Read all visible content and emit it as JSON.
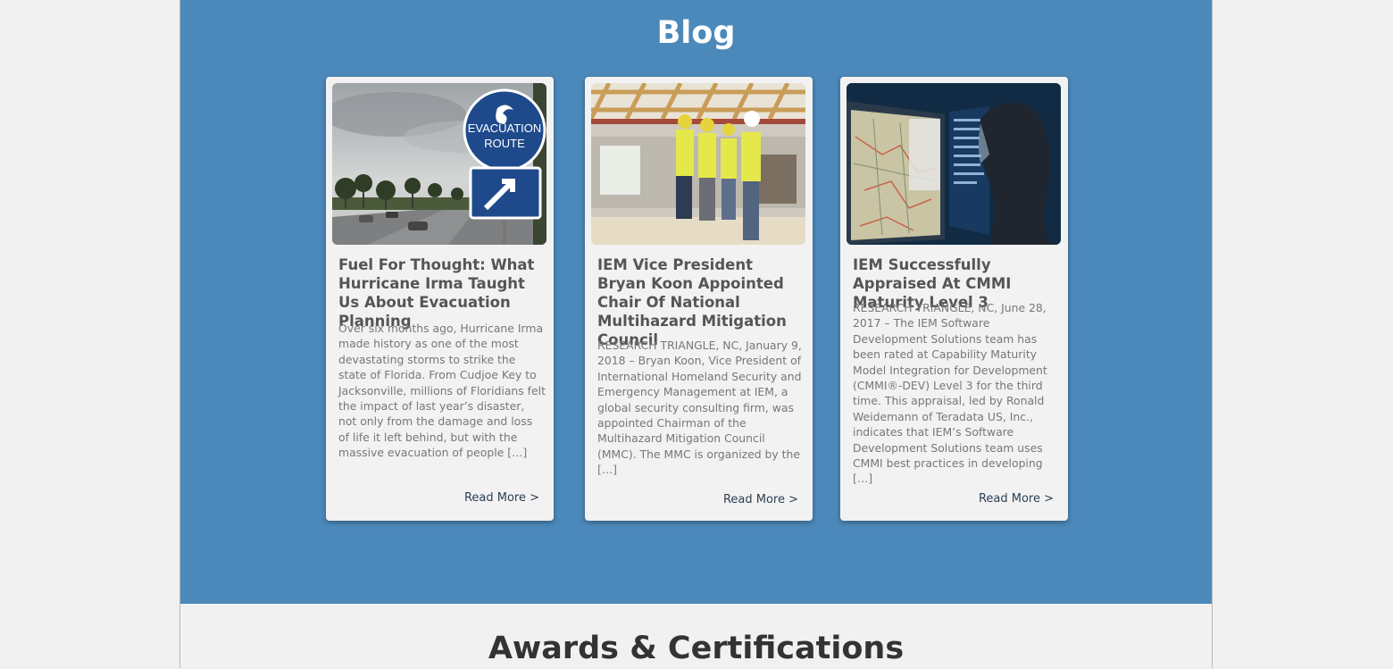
{
  "blog": {
    "title": "Blog",
    "posts": [
      {
        "title": "Fuel For Thought: What Hurricane Irma Taught Us About Evacuation Planning",
        "excerpt": "Over six months ago, Hurricane Irma made history as one of the most devastating storms to strike the state of Florida. From Cudjoe Key to Jacksonville, millions of Floridians felt the impact of last year’s disaster, not only from the damage and loss of life it left behind, but with the massive evacuation of people […]",
        "read_more": "Read More >",
        "image": {
          "sign_line1": "EVACUATION",
          "sign_line2": "ROUTE"
        }
      },
      {
        "title": "IEM Vice President Bryan Koon Appointed Chair Of National Multihazard Mitigation Council",
        "excerpt": "RESEARCH TRIANGLE, NC, January 9, 2018 – Bryan Koon, Vice President of International Homeland Security and Emergency Management at IEM, a global security consulting firm, was appointed Chairman of the Multihazard Mitigation Council (MMC). The MMC is organized by the […]",
        "read_more": "Read More >"
      },
      {
        "title": "IEM Successfully Appraised At CMMI Maturity Level 3",
        "excerpt": "RESEARCH TRIANGLE, NC, June 28, 2017 – The IEM Software Development Solutions team has been rated at Capability Maturity Model Integration for Development (CMMI®-DEV) Level 3 for the third time. This appraisal, led by Ronald Weidemann of Teradata US, Inc., indicates that IEM’s Software Development Solutions team uses CMMI best practices in developing […]",
        "read_more": "Read More >"
      }
    ]
  },
  "awards": {
    "title": "Awards & Certifications"
  },
  "colors": {
    "blog_bg": "#4c89bb",
    "card_bg": "#f2f2f2",
    "page_bg": "#f0f0f1"
  }
}
